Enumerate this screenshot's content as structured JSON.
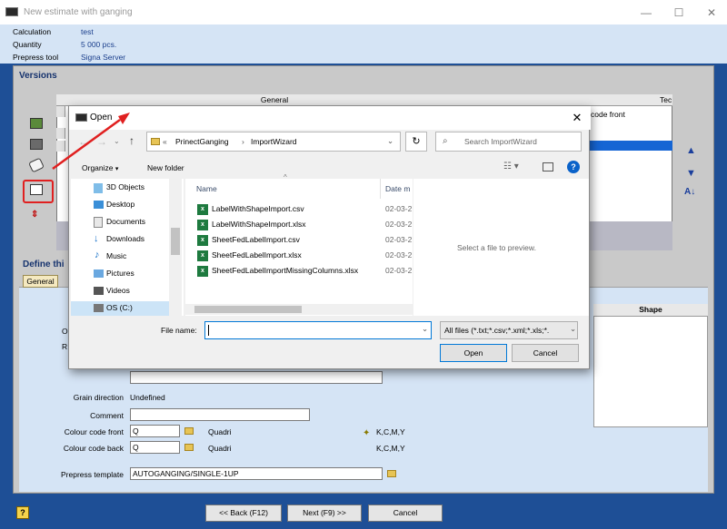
{
  "window": {
    "title": "New estimate with ganging",
    "min": "—",
    "max": "☐",
    "close": "✕"
  },
  "info": [
    {
      "label": "Calculation",
      "value": "test"
    },
    {
      "label": "Quantity",
      "value": "5 000 pcs."
    },
    {
      "label": "Prepress tool",
      "value": "Signa Server"
    }
  ],
  "versions": {
    "title": "Versions",
    "grid": {
      "group_header": "General",
      "col_te": "Tec",
      "col_code_front": "code front"
    }
  },
  "define": {
    "title": "Define thi",
    "tab": "General",
    "label_o": "O",
    "label_r": "R",
    "grain_label": "Grain direction",
    "grain_value": "Undefined",
    "comment_label": "Comment",
    "comment_value": "",
    "colour_front_label": "Colour code front",
    "colour_front_value": "Q",
    "colour_front_desc": "Quadri",
    "colour_front_kcmy": "K,C,M,Y",
    "colour_back_label": "Colour code back",
    "colour_back_value": "Q",
    "colour_back_desc": "Quadri",
    "colour_back_kcmy": "K,C,M,Y",
    "prepress_label": "Prepress template",
    "prepress_value": "AUTOGANGING/SINGLE-1UP",
    "shape_header": "Shape"
  },
  "bottom": {
    "back": "<< Back (F12)",
    "next": "Next (F9) >>",
    "cancel": "Cancel"
  },
  "dialog": {
    "title": "Open",
    "address": {
      "prefix": "«",
      "folder1": "PrinectGanging",
      "sep": "›",
      "folder2": "ImportWizard"
    },
    "search_placeholder": "Search ImportWizard",
    "organize": "Organize",
    "new_folder": "New folder",
    "nav_items": [
      "3D Objects",
      "Desktop",
      "Documents",
      "Downloads",
      "Music",
      "Pictures",
      "Videos",
      "OS (C:)"
    ],
    "columns": {
      "name": "Name",
      "date": "Date m"
    },
    "files": [
      {
        "name": "LabelWithShapeImport.csv",
        "date": "02-03-2"
      },
      {
        "name": "LabelWithShapeImport.xlsx",
        "date": "02-03-2"
      },
      {
        "name": "SheetFedLabelImport.csv",
        "date": "02-03-2"
      },
      {
        "name": "SheetFedLabelImport.xlsx",
        "date": "02-03-2"
      },
      {
        "name": "SheetFedLabelImportMissingColumns.xlsx",
        "date": "02-03-2"
      }
    ],
    "preview_text": "Select a file to preview.",
    "filename_label": "File name:",
    "filename_value": "",
    "filetype": "All files (*.txt;*.csv;*.xml;*.xls;*.",
    "open": "Open",
    "cancel": "Cancel"
  },
  "colors": {
    "accent_blue": "#1e4f96",
    "info_band": "#d5e4f5",
    "annotation_red": "#e02020"
  }
}
